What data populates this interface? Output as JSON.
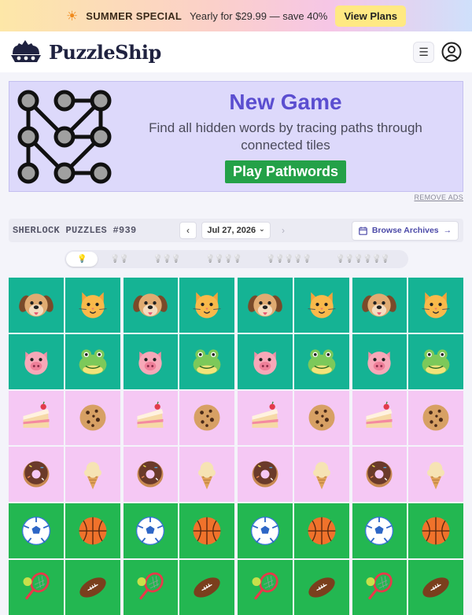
{
  "promo": {
    "icon": "sun-icon",
    "headline": "SUMMER SPECIAL",
    "offer": "Yearly for $29.99 — save 40%",
    "cta": "View Plans"
  },
  "header": {
    "logo_text": "PuzzleShip",
    "menu_icon": "☰"
  },
  "ad": {
    "title": "New Game",
    "description": "Find all hidden words by tracing paths through connected tiles",
    "cta": "Play Pathwords",
    "remove_label": "REMOVE ADS"
  },
  "toolbar": {
    "title": "SHERLOCK PUZZLES #939",
    "prev_label": "‹",
    "next_label": "›",
    "date": "Jul 27, 2026",
    "date_caret": "⌄",
    "archives_label": "Browse Archives",
    "archives_arrow": "→"
  },
  "difficulty": {
    "levels": [
      "1 bulb",
      "2 bulbs",
      "3 bulbs",
      "4 bulbs",
      "5 bulbs",
      "6 bulbs"
    ],
    "selected_level": 1
  },
  "board": {
    "colors": {
      "animals": "#15b394",
      "food": "#f5c8f4",
      "sports": "#23b751"
    },
    "grid_count": 4,
    "rows": [
      {
        "category": "animals",
        "items": [
          "dog",
          "cat"
        ]
      },
      {
        "category": "animals",
        "items": [
          "pig",
          "frog"
        ]
      },
      {
        "category": "food",
        "items": [
          "cake",
          "cookie"
        ]
      },
      {
        "category": "food",
        "items": [
          "donut",
          "ice-cream"
        ]
      },
      {
        "category": "sports",
        "items": [
          "soccer-ball",
          "basketball"
        ]
      },
      {
        "category": "sports",
        "items": [
          "tennis",
          "football"
        ]
      }
    ]
  }
}
